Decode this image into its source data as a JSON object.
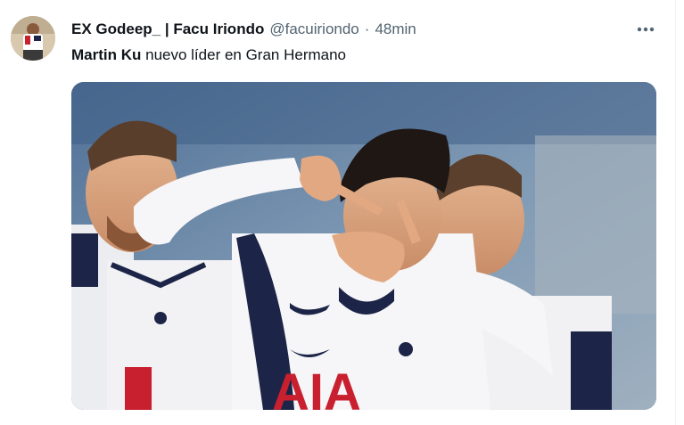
{
  "tweet": {
    "author": {
      "display_name": "EX Godeep_ | Facu Iriondo",
      "handle": "@facuiriondo",
      "separator": "·",
      "time_ago": "48min",
      "avatar_icon": "user-avatar"
    },
    "text": {
      "mention": "Martin Ku",
      "body": " nuevo líder en Gran Hermano"
    },
    "more_icon": "more-horizontal-icon",
    "media": {
      "kind": "photo",
      "jersey_text": "AIA"
    }
  },
  "colors": {
    "primary_text": "#0f1419",
    "secondary_text": "#536471",
    "background": "#ffffff",
    "photo_sky": "#6e8aa8",
    "jersey_navy": "#1c2547",
    "jersey_red": "#c8202f"
  }
}
